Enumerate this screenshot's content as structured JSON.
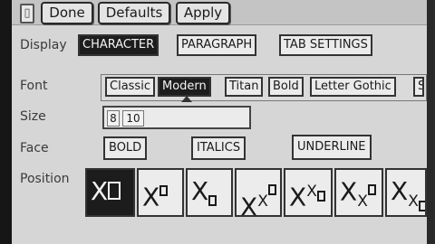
{
  "toolbar": {
    "done_label": "Done",
    "defaults_label": "Defaults",
    "apply_label": "Apply"
  },
  "display": {
    "label": "Display",
    "tabs": [
      "CHARACTER",
      "PARAGRAPH",
      "TAB SETTINGS"
    ],
    "selected": "CHARACTER"
  },
  "font": {
    "label": "Font",
    "options": [
      "Classic",
      "Modern",
      "Titan",
      "Bold",
      "Letter Gothic",
      "S"
    ],
    "selected": "Modern"
  },
  "size": {
    "label": "Size",
    "values": [
      "8",
      "10"
    ]
  },
  "face": {
    "label": "Face",
    "options": [
      "BOLD",
      "ITALICS",
      "UNDERLINE"
    ]
  },
  "position": {
    "label": "Position",
    "selected_index": 0
  },
  "colors": {
    "selected_bg": "#1d1d1d",
    "panel_bg": "#d6d6d6"
  }
}
